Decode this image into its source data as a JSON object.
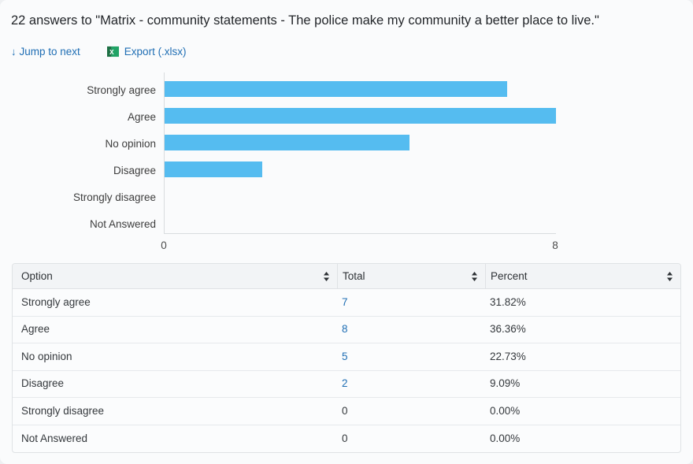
{
  "header": {
    "title": "22 answers to \"Matrix - community statements - The police make my community a better place to live.\"",
    "jump_arrow": "↓",
    "jump_label": "Jump to next",
    "export_label": "Export (.xlsx)",
    "export_icon": "excel-xlsx-icon"
  },
  "colors": {
    "bar": "#55bcf0",
    "link": "#1f6eb4",
    "axis": "#d9dcdf",
    "header_row_bg": "#f2f4f6",
    "excel_green": "#1d7044",
    "excel_green_light": "#21a366"
  },
  "chart_data": {
    "type": "bar",
    "orientation": "horizontal",
    "title": "",
    "xlabel": "",
    "ylabel": "",
    "categories": [
      "Strongly agree",
      "Agree",
      "No opinion",
      "Disagree",
      "Strongly disagree",
      "Not Answered"
    ],
    "values": [
      7,
      8,
      5,
      2,
      0,
      0
    ],
    "xlim": [
      0,
      8
    ],
    "xticks": [
      0,
      8
    ],
    "xtick_labels": [
      "0",
      "8"
    ],
    "grid": false,
    "legend": false
  },
  "table": {
    "columns": [
      {
        "label": "Option",
        "sortable": true
      },
      {
        "label": "Total",
        "sortable": true
      },
      {
        "label": "Percent",
        "sortable": true
      }
    ],
    "rows": [
      {
        "option": "Strongly agree",
        "total": "7",
        "total_is_link": true,
        "percent": "31.82%"
      },
      {
        "option": "Agree",
        "total": "8",
        "total_is_link": true,
        "percent": "36.36%"
      },
      {
        "option": "No opinion",
        "total": "5",
        "total_is_link": true,
        "percent": "22.73%"
      },
      {
        "option": "Disagree",
        "total": "2",
        "total_is_link": true,
        "percent": "9.09%"
      },
      {
        "option": "Strongly disagree",
        "total": "0",
        "total_is_link": false,
        "percent": "0.00%"
      },
      {
        "option": "Not Answered",
        "total": "0",
        "total_is_link": false,
        "percent": "0.00%"
      }
    ]
  }
}
